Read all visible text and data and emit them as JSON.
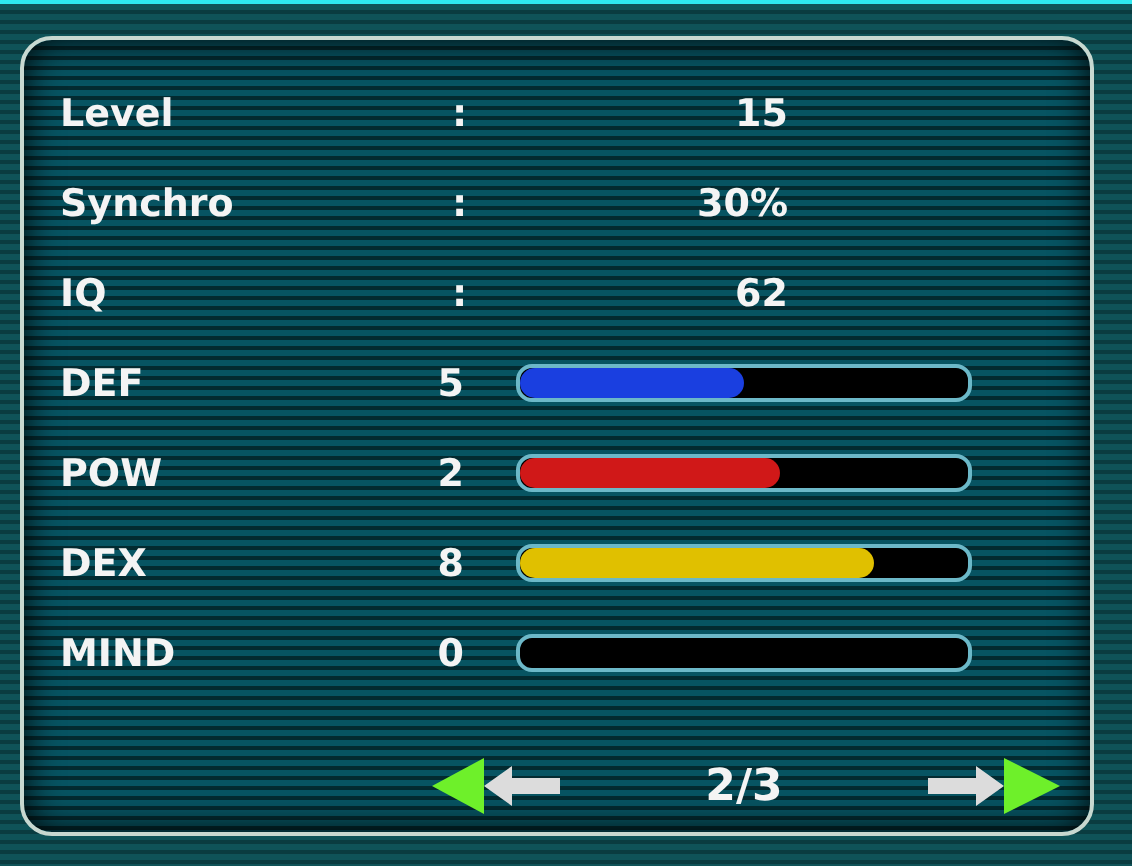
{
  "info_rows": [
    {
      "label": "Level",
      "separator": ":",
      "value": "15"
    },
    {
      "label": "Synchro",
      "separator": ":",
      "value": "30%"
    },
    {
      "label": "IQ",
      "separator": ":",
      "value": "62"
    }
  ],
  "stats": [
    {
      "label": "DEF",
      "value": "5",
      "level": 0.5,
      "color": "#1a3fe0"
    },
    {
      "label": "POW",
      "value": "2",
      "level": 0.58,
      "color": "#d01818"
    },
    {
      "label": "DEX",
      "value": "8",
      "level": 0.79,
      "color": "#e0c000"
    },
    {
      "label": "MIND",
      "value": "0"
    }
  ],
  "pager": {
    "text": "2/3"
  }
}
